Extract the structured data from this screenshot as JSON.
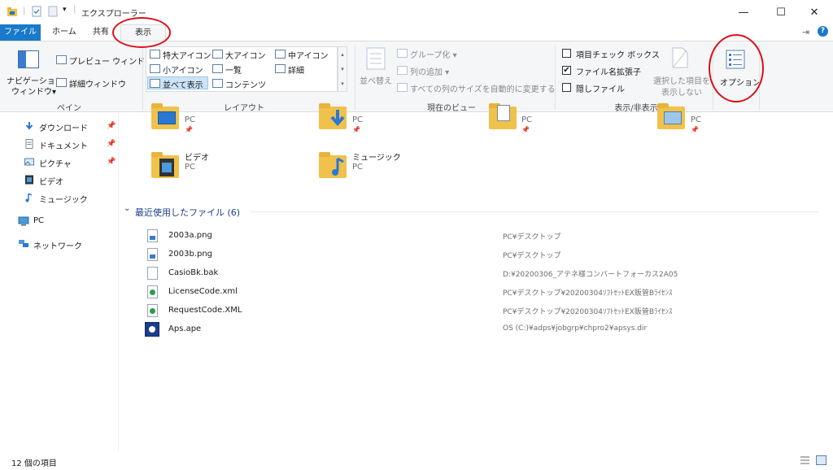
{
  "window": {
    "title": "エクスプローラー",
    "minimize": "—",
    "maximize": "☐",
    "close": "✕",
    "pin_glyph": "⇥",
    "help_glyph": "?"
  },
  "tabs": {
    "file": "ファイル",
    "home": "ホーム",
    "share": "共有",
    "view": "表示"
  },
  "ribbon": {
    "pane": {
      "nav_pane_line1": "ナビゲーション",
      "nav_pane_line2": "ウィンドウ▾",
      "preview": "プレビュー ウィンドウ",
      "details": "詳細ウィンドウ",
      "label": "ペイン"
    },
    "layout": {
      "xl_icons": "特大アイコン",
      "l_icons": "大アイコン",
      "m_icons": "中アイコン",
      "s_icons": "小アイコン",
      "list": "一覧",
      "details": "詳細",
      "tiles": "並べて表示",
      "content": "コンテンツ",
      "label": "レイアウト"
    },
    "current_view": {
      "sort_line1": "並べ替え",
      "group_by": "グループ化 ▾",
      "add_columns": "列の追加 ▾",
      "size_all": "すべての列のサイズを自動的に変更する",
      "label": "現在のビュー"
    },
    "show_hide": {
      "item_checkbox": "項目チェック ボックス",
      "file_ext": "ファイル名拡張子",
      "hidden": "隠しファイル",
      "hide_selected_line1": "選択した項目を",
      "hide_selected_line2": "表示しない",
      "label": "表示/非表示"
    },
    "options": {
      "label": "オプション"
    }
  },
  "nav": {
    "items": [
      {
        "label": "ダウンロード",
        "icon": "download-icon"
      },
      {
        "label": "ドキュメント",
        "icon": "document-icon"
      },
      {
        "label": "ピクチャ",
        "icon": "pictures-icon"
      },
      {
        "label": "ビデオ",
        "icon": "video-icon"
      },
      {
        "label": "ミュージック",
        "icon": "music-icon"
      },
      {
        "label": "PC",
        "icon": "pc-icon"
      },
      {
        "label": "ネットワーク",
        "icon": "network-icon"
      }
    ],
    "pin_glyph": "📌"
  },
  "content": {
    "top_tiles": [
      {
        "sub": "PC"
      },
      {
        "sub": "PC"
      },
      {
        "sub": "PC"
      },
      {
        "sub": "PC"
      }
    ],
    "tiles": [
      {
        "name": "ビデオ",
        "sub": "PC"
      },
      {
        "name": "ミュージック",
        "sub": "PC"
      }
    ],
    "recent_header": "最近使用したファイル (6)",
    "recent_files": [
      {
        "name": "2003a.png",
        "path": "PC¥デスクトップ"
      },
      {
        "name": "2003b.png",
        "path": "PC¥デスクトップ"
      },
      {
        "name": "CasioBk.bak",
        "path": "D:¥20200306_アテネ様コンバートフォーカス2A05"
      },
      {
        "name": "LicenseCode.xml",
        "path": "PC¥デスクトップ¥20200304ｿﾌﾄｾｯﾄEX販管Bﾗｲｾﾝｽ"
      },
      {
        "name": "RequestCode.XML",
        "path": "PC¥デスクトップ¥20200304ｿﾌﾄｾｯﾄEX販管Bﾗｲｾﾝｽ"
      },
      {
        "name": "Aps.ape",
        "path": "OS (C:)¥adps¥jobgrp¥chpro2¥apsys.dir"
      }
    ]
  },
  "status": {
    "count": "12 個の項目"
  },
  "colors": {
    "accent": "#1979ca",
    "annotation": "#d9111b",
    "folder": "#f0c14b"
  }
}
